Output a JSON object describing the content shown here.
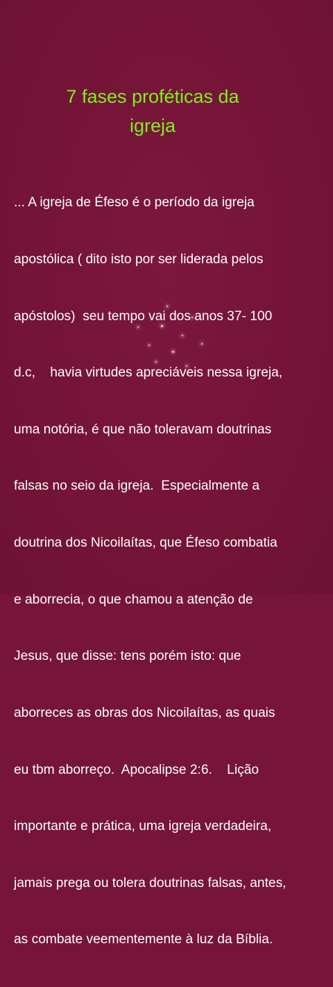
{
  "title": {
    "line1": "7 fases proféticas da",
    "line2": "igreja"
  },
  "body": {
    "lines": [
      "... A igreja de Éfeso é o período da igreja",
      "apostólica ( dito isto por ser liderada pelos",
      "apóstolos)  seu tempo vai dos anos 37- 100",
      "d.c,    havia virtudes apreciáveis nessa igreja,",
      "uma notória, é que não toleravam doutrinas",
      "falsas no seio da igreja.  Especialmente a",
      "doutrina dos Nicoilaítas, que Éfeso combatia",
      "e aborrecia, o que chamou a atenção de",
      "Jesus, que disse: tens porém isto: que",
      "aborreces as obras dos Nicoilaítas, as quais",
      "eu tbm aborreço.  Apocalipse 2:6.    Lição",
      "importante e prática, uma igreja verdadeira,",
      "jamais prega ou tolera doutrinas falsas, antes,",
      "as combate veementemente à luz da Bíblia."
    ]
  },
  "colors": {
    "background": "#761539",
    "title": "#7bf21c",
    "text": "#ffffff"
  }
}
